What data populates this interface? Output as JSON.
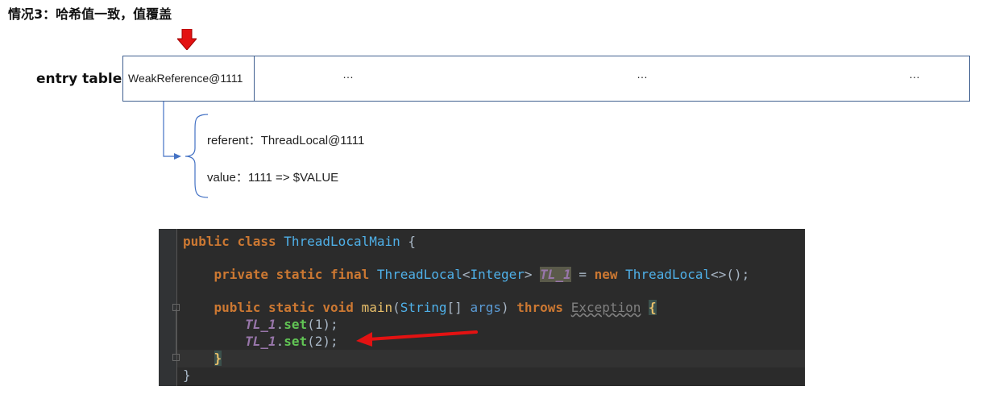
{
  "heading": "情况3：哈希值一致，值覆盖",
  "entry_label": "entry table",
  "table": {
    "first_cell": "WeakReference@1111",
    "ellipses": [
      "…",
      "…",
      "…"
    ]
  },
  "fields": {
    "referent": "referent：ThreadLocal@1111",
    "value": "value：1111  => $VALUE"
  },
  "code": {
    "line1": {
      "kw1": "public",
      "kw2": "class",
      "cls": "ThreadLocalMain",
      "tail": " {"
    },
    "line2": {
      "kw1": "private",
      "kw2": "static",
      "kw3": "final",
      "type1": "ThreadLocal",
      "lt": "<",
      "type2": "Integer",
      "gt": "> ",
      "field": "TL_1",
      "eq": " = ",
      "kw_new": "new",
      "type3": "ThreadLocal",
      "tail": "<>();"
    },
    "line3": {
      "kw1": "public",
      "kw2": "static",
      "kw3": "void",
      "method": "main",
      "open": "(",
      "ptype": "String",
      "arr": "[] ",
      "param": "args",
      "close": ") ",
      "kw_throws": "throws",
      "exc": "Exception",
      "brace": "{"
    },
    "line4": {
      "field": "TL_1",
      "dot": ".",
      "call": "set",
      "args": "(1);"
    },
    "line5": {
      "field": "TL_1",
      "dot": ".",
      "call": "set",
      "args": "(2);"
    },
    "line6": {
      "brace": "}"
    },
    "line7": {
      "brace": "}"
    }
  },
  "colors": {
    "arrow": "#e31212",
    "table_border": "#3f5f8f",
    "connector": "#4472c4",
    "code_bg": "#2b2b2b"
  }
}
